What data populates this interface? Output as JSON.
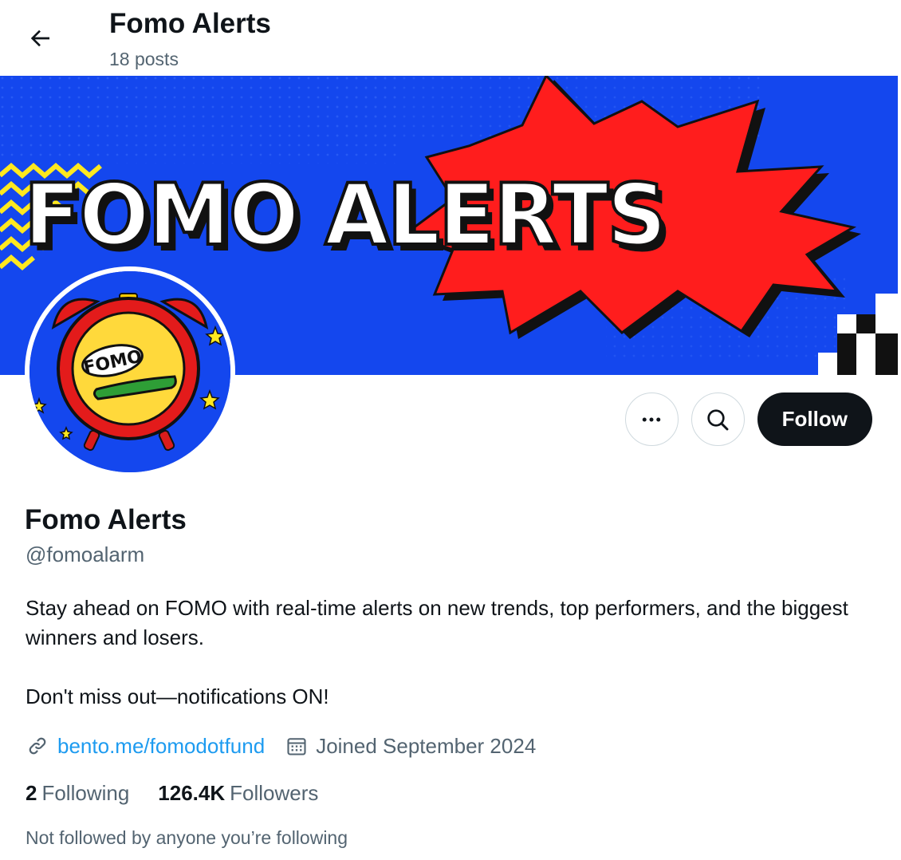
{
  "header": {
    "title": "Fomo Alerts",
    "post_count": "18 posts",
    "back_icon": "arrow-left-icon"
  },
  "banner": {
    "text": "FOMO ALERTS",
    "bg_color": "#1447ee",
    "burst_color": "#ff1d1d",
    "zigzag_color": "#ffe81f"
  },
  "avatar": {
    "badge_text": "FOMO"
  },
  "actions": {
    "more_icon": "more-dots-icon",
    "search_icon": "search-icon",
    "follow_label": "Follow"
  },
  "profile": {
    "name": "Fomo Alerts",
    "handle": "@fomoalarm",
    "bio_line1": "Stay ahead on FOMO with real-time alerts on new trends, top performers, and the biggest winners and losers.",
    "bio_line2": "Don't miss out—notifications ON!",
    "website": "bento.me/fomodotfund",
    "joined": "Joined September 2024"
  },
  "stats": {
    "following_count": "2",
    "following_label": "Following",
    "followers_count": "126.4K",
    "followers_label": "Followers"
  },
  "social_context": "Not followed by anyone you’re following",
  "colors": {
    "text": "#0f1419",
    "muted": "#536471",
    "link": "#1d9bf0",
    "button": "#0f1419"
  }
}
